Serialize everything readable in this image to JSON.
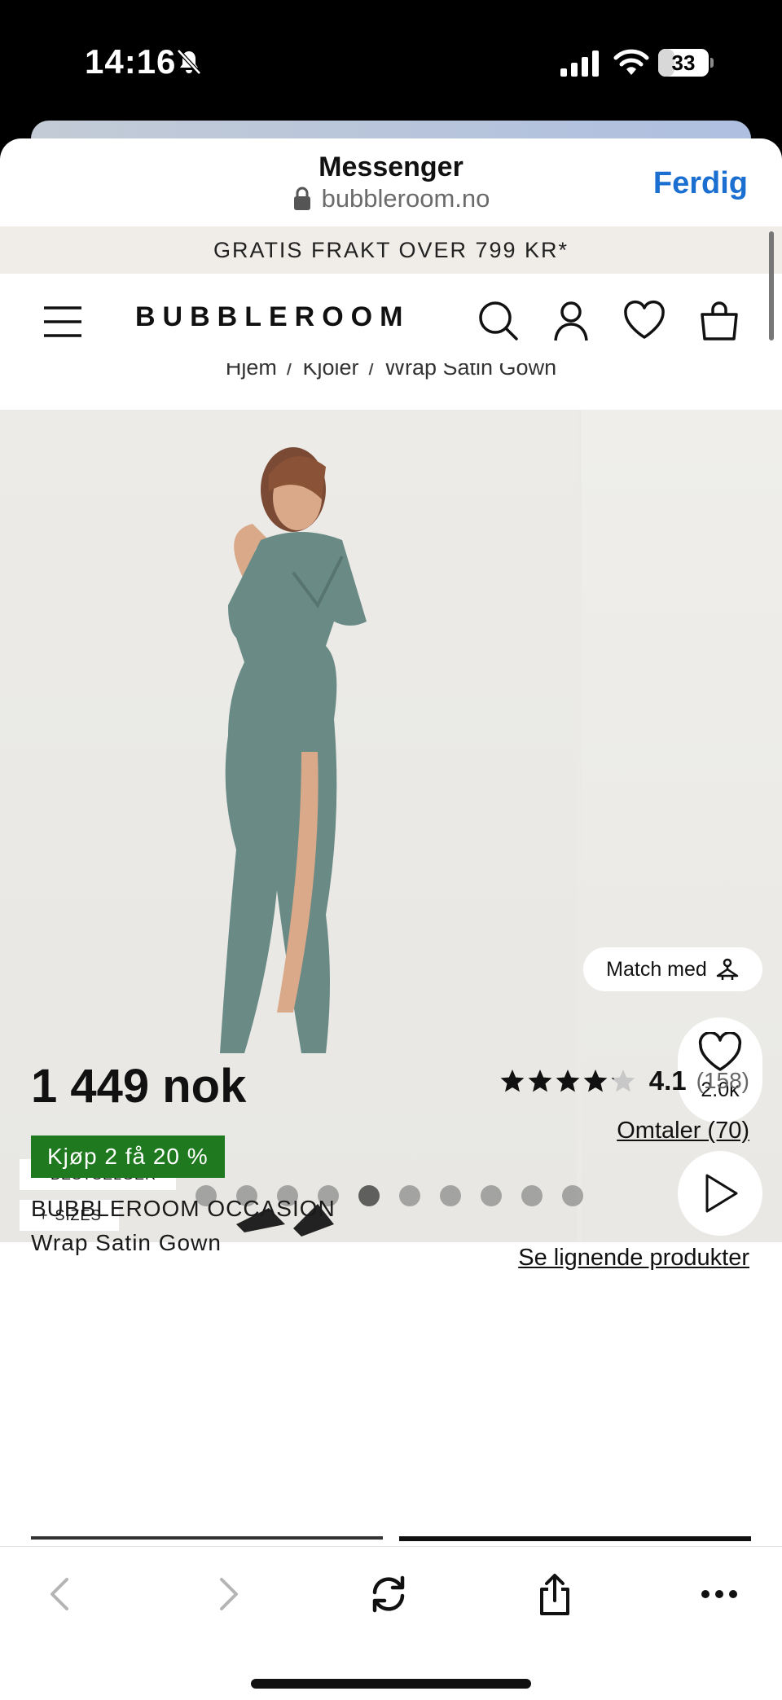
{
  "status_bar": {
    "time": "14:16",
    "battery": "33",
    "battery_level": 0.33
  },
  "browser": {
    "title": "Messenger",
    "url": "bubbleroom.no",
    "done_label": "Ferdig"
  },
  "promo": {
    "text": "GRATIS FRAKT OVER 799 KR*"
  },
  "header": {
    "logo": "BUBBLEROOM"
  },
  "breadcrumb": {
    "items": [
      "Hjem",
      "Kjoler",
      "Wrap Satin Gown"
    ],
    "separator": "/"
  },
  "gallery": {
    "match_label": "Match med",
    "like_count": "2.0k",
    "tags": {
      "bestseller": "BESTSELGER",
      "sizes": "SIZES"
    },
    "dot_count": 10,
    "active_dot": 5
  },
  "product": {
    "price": "1 449 nok",
    "offer": "Kjøp 2 få 20 %",
    "brand": "BUBBLEROOM OCCASION",
    "name": "Wrap Satin Gown",
    "rating": "4.1",
    "rating_value": 4.1,
    "rating_count": "(158)",
    "reviews_link": "Omtaler (70)",
    "similar_link": "Se lignende produkter",
    "offer_color": "#1f7a1f",
    "dress_color": "#6a8a86"
  },
  "colors": {
    "accent": "#1a6fd1"
  }
}
